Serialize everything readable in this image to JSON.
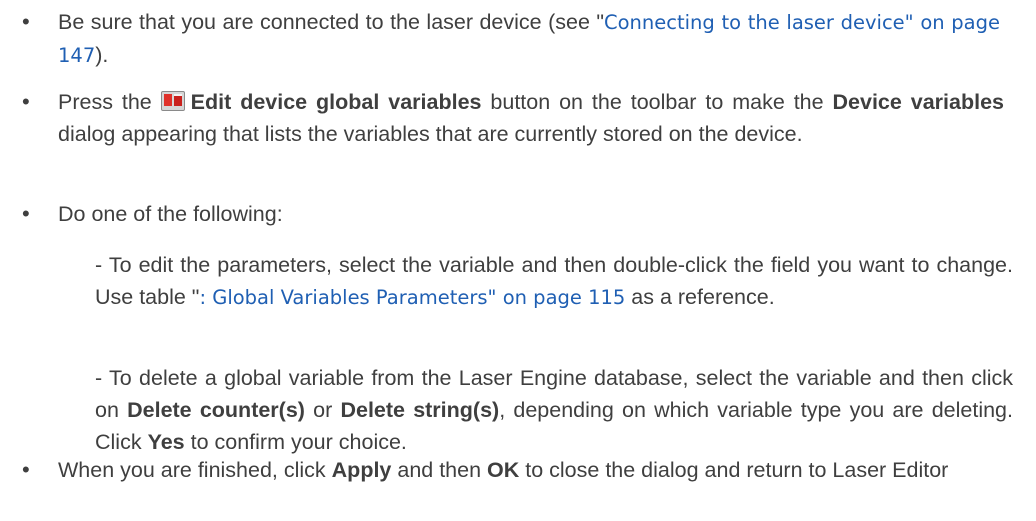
{
  "bullets": [
    {
      "before": "Be sure that you are connected to the laser device (see \"",
      "link": "Connecting to the laser device\" on page 147",
      "after": ")."
    },
    {
      "before": "Press the ",
      "icon": "edit-device-global-variables-icon",
      "bold1": "Edit device global variables",
      "middle": " button on the toolbar to make the ",
      "bold2": "Device variables",
      "after": " dialog appearing that lists the variables that are currently stored on the device."
    },
    {
      "text": "Do one of the following:"
    },
    {
      "text": "When you are finished, click ",
      "bold1": "Apply",
      "middle": " and then ",
      "bold2": "OK",
      "after": " to close the dialog and return to Laser Editor"
    }
  ],
  "sub_items": [
    {
      "before": "- To edit the parameters, select the variable and then double-click the field you want to change. Use table \"",
      "link": ": Global Variables Parameters\" on page 115",
      "after": " as a reference."
    },
    {
      "before": "- To delete a global variable from the Laser Engine database, select the variable and then click on ",
      "bold1": "Delete counter(s)",
      "middle": " or ",
      "bold2": "Delete string(s)",
      "middle2": ", depending on which variable type you are deleting. Click ",
      "bold3": "Yes",
      "after": " to confirm your choice."
    }
  ],
  "bullet_glyph": "•",
  "colors": {
    "text": "#3f3f3f",
    "link": "#1f5fb3",
    "icon_red": "#e0312a"
  }
}
